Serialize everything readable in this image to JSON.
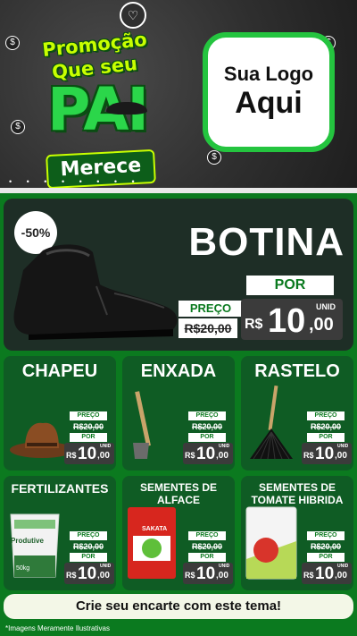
{
  "header": {
    "promo_line1": "Promoção",
    "promo_line2": "Que seu",
    "promo_pai": "PAI",
    "promo_merece": "Merece",
    "logo_line1": "Sua Logo",
    "logo_line2": "Aqui",
    "heart_glyph": "♡",
    "coin_glyph": "$",
    "dots": "• • • • • • • •"
  },
  "featured": {
    "discount": "-50%",
    "title": "BOTINA",
    "preco_label": "PREÇO",
    "old_price": "R$20,00",
    "por_label": "POR",
    "currency": "R$",
    "price_int": "10",
    "price_cents": ",00",
    "unit": "UNID"
  },
  "products": [
    {
      "title": "CHAPEU",
      "preco_label": "PREÇO",
      "old_price": "R$20,00",
      "por_label": "POR",
      "currency": "R$",
      "price_int": "10",
      "price_cents": ",00",
      "unit": "UNID",
      "image": "hat"
    },
    {
      "title": "ENXADA",
      "preco_label": "PREÇO",
      "old_price": "R$20,00",
      "por_label": "POR",
      "currency": "R$",
      "price_int": "10",
      "price_cents": ",00",
      "unit": "UNID",
      "image": "hoe"
    },
    {
      "title": "RASTELO",
      "preco_label": "PREÇO",
      "old_price": "R$20,00",
      "por_label": "POR",
      "currency": "R$",
      "price_int": "10",
      "price_cents": ",00",
      "unit": "UNID",
      "image": "rake"
    },
    {
      "title": "FERTILIZANTES",
      "preco_label": "PREÇO",
      "old_price": "R$20,00",
      "por_label": "POR",
      "currency": "R$",
      "price_int": "10",
      "price_cents": ",00",
      "unit": "UNID",
      "image": "fertilizer-bag",
      "bag_brand": "Produtive",
      "bag_weight": "50kg"
    },
    {
      "title": "SEMENTES DE ALFACE",
      "preco_label": "PREÇO",
      "old_price": "R$20,00",
      "por_label": "POR",
      "currency": "R$",
      "price_int": "10",
      "price_cents": ",00",
      "unit": "UNID",
      "image": "lettuce-seeds",
      "pack_brand": "SAKATA"
    },
    {
      "title": "SEMENTES DE TOMATE HIBRIDA",
      "preco_label": "PREÇO",
      "old_price": "R$20,00",
      "por_label": "POR",
      "currency": "R$",
      "price_int": "10",
      "price_cents": ",00",
      "unit": "UNID",
      "image": "tomato-seeds"
    }
  ],
  "footer": {
    "banner": "Crie seu encarte com este tema!",
    "note": "*Imagens Meramente Ilustrativas"
  },
  "colors": {
    "page_green": "#0b7a1f",
    "card_green": "#0f5c24",
    "featured_bg": "#1e2e26",
    "accent_lime": "#c8ff00",
    "logo_border": "#24c43f"
  }
}
